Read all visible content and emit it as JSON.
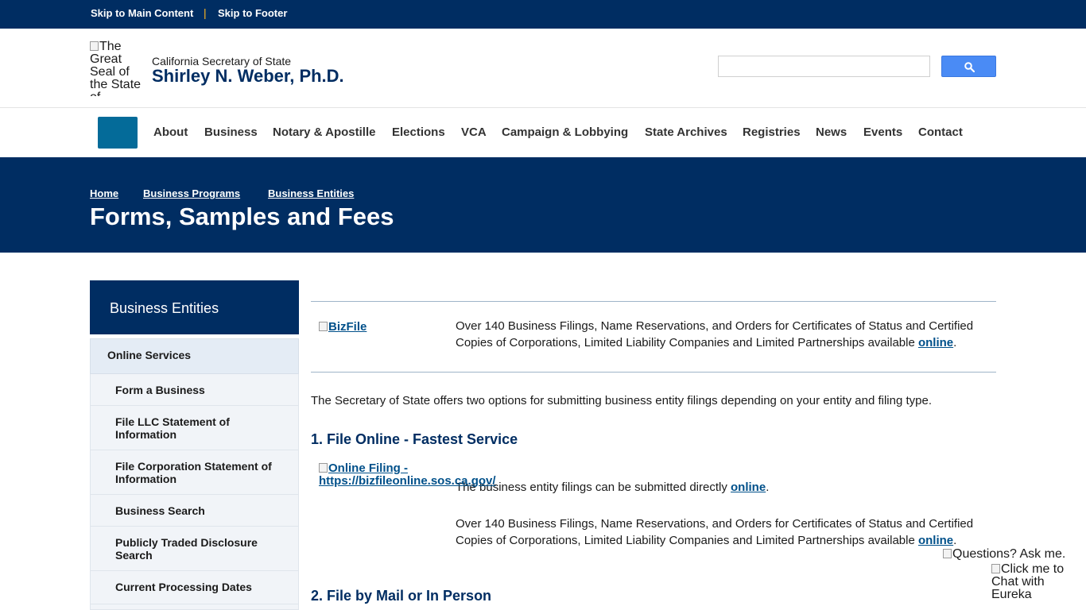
{
  "skip": {
    "main": "Skip to Main Content",
    "separator": "|",
    "footer": "Skip to Footer"
  },
  "header": {
    "seal_alt": "The Great Seal of the State of California",
    "agency": "California Secretary of State",
    "official": "Shirley N. Weber, Ph.D.",
    "search_placeholder": ""
  },
  "nav": {
    "items": [
      "About",
      "Business",
      "Notary & Apostille",
      "Elections",
      "VCA",
      "Campaign & Lobbying",
      "State Archives",
      "Registries",
      "News",
      "Events",
      "Contact"
    ]
  },
  "banner": {
    "breadcrumbs": [
      "Home",
      "Business Programs",
      "Business Entities"
    ],
    "title": "Forms, Samples and Fees"
  },
  "sidebar": {
    "heading": "Business Entities",
    "group": "Online Services",
    "items": [
      "Form a Business",
      "File LLC Statement of Information",
      "File Corporation Statement of Information",
      "Business Search",
      "Publicly Traded Disclosure Search",
      "Current Processing Dates"
    ]
  },
  "main": {
    "bizfile_alt": "BizFile",
    "bizfile_text": "Over 140 Business Filings, Name Reservations, and Orders for Certificates of Status and Certified Copies of Corporations, Limited Liability Companies and Limited Partnerships available ",
    "bizfile_link": "online",
    "intro": "The Secretary of State offers two options for submitting business entity filings depending on your entity and filing type.",
    "h_online": "1. File Online - Fastest Service",
    "online_alt": "Online Filing - https://bizfileonline.sos.ca.gov/",
    "online_text": "The business entity filings can be submitted directly ",
    "online_link": "online",
    "online_text2": "Over 140 Business Filings, Name Reservations, and Orders for Certificates of Status and Certified Copies of Corporations, Limited Liability Companies and Limited Partnerships available ",
    "online_link2": "online",
    "h_mail": "2. File by Mail or In Person",
    "period": "."
  },
  "chat": {
    "question_alt": "Questions? Ask me.",
    "chat_alt": "Click me to Chat with Eureka"
  },
  "colors": {
    "navy": "#002d62",
    "menu_button": "#046b99",
    "search_button": "#4a8bf5",
    "link": "#00508a"
  }
}
